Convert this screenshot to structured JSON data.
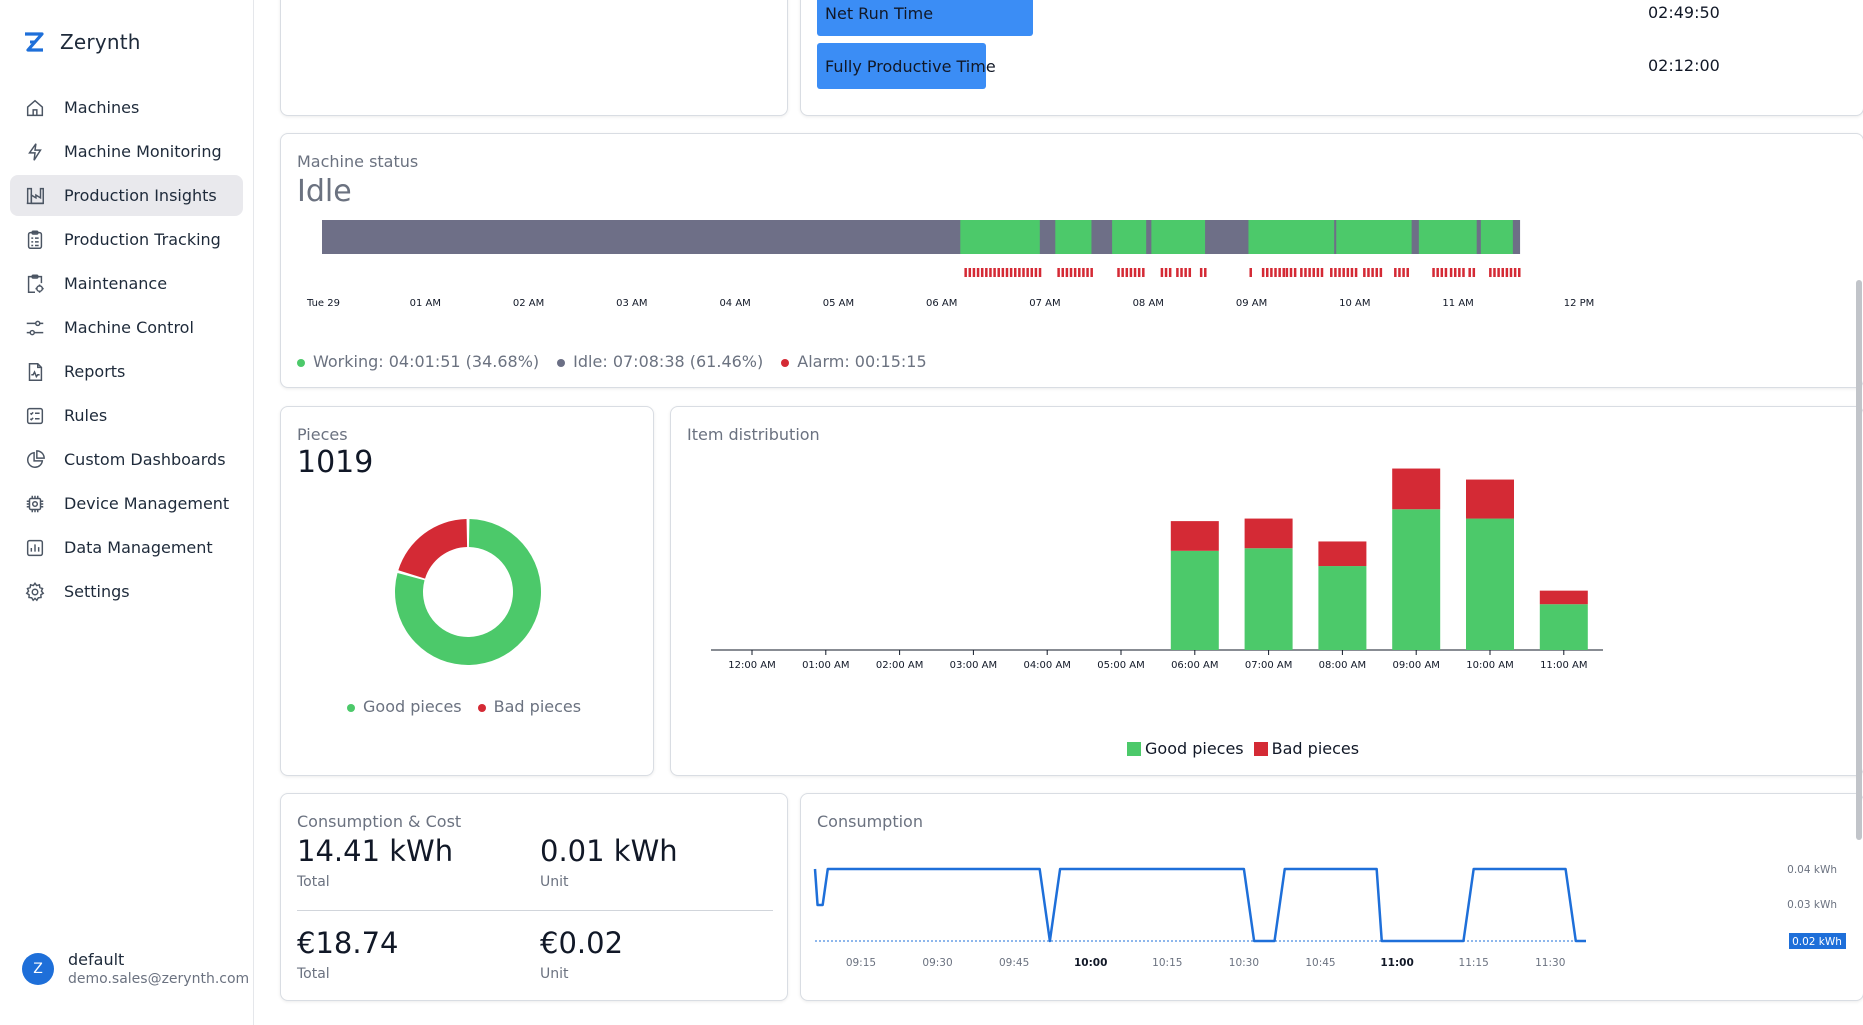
{
  "app": {
    "name": "Zerynth"
  },
  "sidebar": {
    "items": [
      {
        "label": "Machines",
        "icon": "home-icon"
      },
      {
        "label": "Machine Monitoring",
        "icon": "bolt-icon"
      },
      {
        "label": "Production Insights",
        "icon": "factory-icon",
        "active": true
      },
      {
        "label": "Production Tracking",
        "icon": "clipboard-icon"
      },
      {
        "label": "Maintenance",
        "icon": "clipboard-gear-icon"
      },
      {
        "label": "Machine Control",
        "icon": "sliders-icon"
      },
      {
        "label": "Reports",
        "icon": "report-icon"
      },
      {
        "label": "Rules",
        "icon": "rules-icon"
      },
      {
        "label": "Custom Dashboards",
        "icon": "pie-icon"
      },
      {
        "label": "Device Management",
        "icon": "chip-icon"
      },
      {
        "label": "Data Management",
        "icon": "bar-chart-icon"
      },
      {
        "label": "Settings",
        "icon": "gear-icon"
      }
    ],
    "user": {
      "initial": "Z",
      "name": "default",
      "email": "demo.sales@zerynth.com"
    }
  },
  "times": {
    "rows": [
      {
        "label": "Net Run Time",
        "value": "02:49:50",
        "fraction": 0.24
      },
      {
        "label": "Fully Productive Time",
        "value": "02:12:00",
        "fraction": 0.188
      }
    ]
  },
  "status": {
    "title": "Machine status",
    "value": "Idle",
    "axis_labels": [
      "Tue 29",
      "01 AM",
      "02 AM",
      "03 AM",
      "04 AM",
      "05 AM",
      "06 AM",
      "07 AM",
      "08 AM",
      "09 AM",
      "10 AM",
      "11 AM",
      "12 PM"
    ],
    "legend": [
      {
        "label": "Working: 04:01:51 (34.68%)",
        "color": "#4cc96a"
      },
      {
        "label": "Idle: 07:08:38 (61.46%)",
        "color": "#6b6f85"
      },
      {
        "label": "Alarm: 00:15:15",
        "color": "#d42a35"
      }
    ],
    "colors": {
      "idle": "#6e6f87",
      "working": "#4cc96a",
      "alarm": "#d42a35"
    },
    "working_segments": [
      [
        6.18,
        6.95
      ],
      [
        7.1,
        7.45
      ],
      [
        7.65,
        7.98
      ],
      [
        8.03,
        8.55
      ],
      [
        8.97,
        9.8
      ],
      [
        9.82,
        10.55
      ],
      [
        10.62,
        11.18
      ],
      [
        11.22,
        11.53
      ]
    ]
  },
  "pieces": {
    "title": "Pieces",
    "total": "1019",
    "legend": [
      "Good pieces",
      "Bad pieces"
    ],
    "chart_data": {
      "type": "pie",
      "labels": [
        "Good pieces",
        "Bad pieces"
      ],
      "values": [
        0.795,
        0.205
      ],
      "colors": [
        "#4cc96a",
        "#d42a35"
      ]
    }
  },
  "distribution": {
    "title": "Item distribution",
    "legend": [
      "Good pieces",
      "Bad pieces"
    ],
    "chart_data": {
      "type": "bar",
      "stacked": true,
      "categories": [
        "12:00 AM",
        "01:00 AM",
        "02:00 AM",
        "03:00 AM",
        "04:00 AM",
        "05:00 AM",
        "06:00 AM",
        "07:00 AM",
        "08:00 AM",
        "09:00 AM",
        "10:00 AM",
        "11:00 AM"
      ],
      "series": [
        {
          "name": "Good pieces",
          "color": "#4cc96a",
          "values": [
            0,
            0,
            0,
            0,
            0,
            0,
            117,
            120,
            99,
            166,
            155,
            54
          ]
        },
        {
          "name": "Bad pieces",
          "color": "#d42a35",
          "values": [
            0,
            0,
            0,
            0,
            0,
            0,
            35,
            35,
            29,
            48,
            46,
            16
          ]
        }
      ],
      "ylim": [
        0,
        214
      ]
    }
  },
  "consumption_cost": {
    "title": "Consumption & Cost",
    "energy_total": "14.41 kWh",
    "energy_total_label": "Total",
    "energy_unit": "0.01 kWh",
    "energy_unit_label": "Unit",
    "cost_total": "€18.74",
    "cost_total_label": "Total",
    "cost_unit": "€0.02",
    "cost_unit_label": "Unit"
  },
  "consumption": {
    "title": "Consumption",
    "chart_data": {
      "type": "line",
      "color": "#1e6fd9",
      "x_ticks": [
        "09:15",
        "09:30",
        "09:45",
        "10:00",
        "10:15",
        "10:30",
        "10:45",
        "11:00",
        "11:15",
        "11:30"
      ],
      "bold_ticks": [
        "10:00",
        "11:00"
      ],
      "y_ticks": [
        "0.04 kWh",
        "0.03 kWh"
      ],
      "current_label": "0.02 kWh",
      "ylim": [
        0.02,
        0.04
      ],
      "xlim": [
        "09:06",
        "09:37"
      ],
      "points": [
        [
          "09:06",
          0.04
        ],
        [
          "09:06.5",
          0.03
        ],
        [
          "09:07.5",
          0.03
        ],
        [
          "09:08.5",
          0.04
        ],
        [
          "09:50",
          0.04
        ],
        [
          "09:52",
          0.02
        ],
        [
          "09:54",
          0.04
        ],
        [
          "10:30",
          0.04
        ],
        [
          "10:32",
          0.02
        ],
        [
          "10:36",
          0.02
        ],
        [
          "10:38",
          0.04
        ],
        [
          "10:56",
          0.04
        ],
        [
          "10:57",
          0.02
        ],
        [
          "11:13",
          0.02
        ],
        [
          "11:15",
          0.04
        ],
        [
          "11:33",
          0.04
        ],
        [
          "11:35",
          0.02
        ],
        [
          "11:37",
          0.02
        ]
      ]
    }
  }
}
